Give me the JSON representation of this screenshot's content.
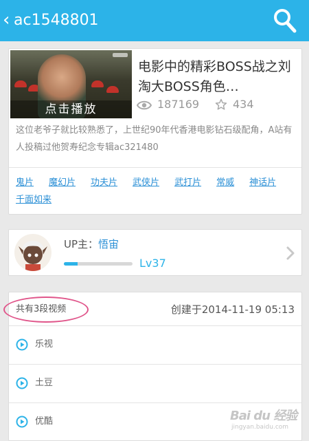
{
  "header": {
    "title": "ac1548801"
  },
  "video": {
    "play_label": "点击播放",
    "title": "电影中的精彩BOSS战之刘淘大BOSS角色…",
    "views": "187169",
    "favorites": "434",
    "description": "这位老爷子就比较熟悉了，上世纪90年代香港电影钻石级配角，A站有人投稿过他贺寿纪念专辑ac321480",
    "tags": [
      "鬼片",
      "魔幻片",
      "功夫片",
      "武侠片",
      "武打片",
      "常威",
      "神话片",
      "千面如来"
    ]
  },
  "uploader": {
    "label": "UP主：",
    "name": "悟宙",
    "level": "Lv37",
    "level_progress": 0.2
  },
  "parts": {
    "count_label": "共有3段视频",
    "created_label": "创建于2014-11-19 05:13",
    "sources": [
      "乐视",
      "土豆",
      "优酷"
    ]
  },
  "watermark": {
    "brand": "Bai du 经验",
    "sub": "jingyan.baidu.com"
  },
  "colors": {
    "accent": "#2cb3e8",
    "link": "#2a8fd6",
    "annotation": "#e0558a"
  }
}
